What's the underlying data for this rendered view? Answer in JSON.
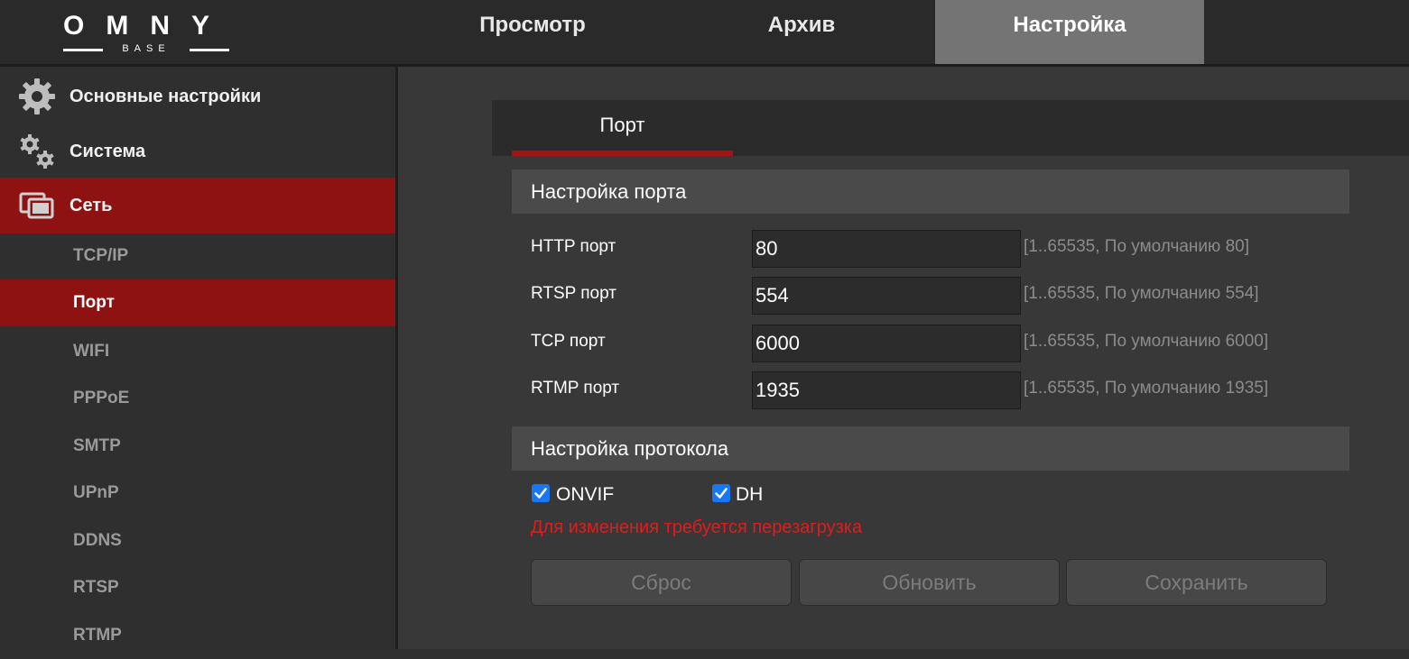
{
  "header": {
    "logo": {
      "main": "OMNY",
      "sub": "BASE"
    },
    "tabs": [
      {
        "label": "Просмотр"
      },
      {
        "label": "Архив"
      },
      {
        "label": "Настройка",
        "active": true
      }
    ]
  },
  "sidebar": {
    "sections": [
      {
        "label": "Основные настройки",
        "icon": "gear-icon"
      },
      {
        "label": "Система",
        "icon": "gears-icon"
      },
      {
        "label": "Сеть",
        "icon": "network-icon",
        "active": true
      }
    ],
    "subitems": [
      "TCP/IP",
      "Порт",
      "WIFI",
      "PPPoE",
      "SMTP",
      "UPnP",
      "DDNS",
      "RTSP",
      "RTMP"
    ],
    "active_subitem": "Порт"
  },
  "main": {
    "tab": "Порт",
    "port_section": {
      "title": "Настройка порта",
      "fields": [
        {
          "label": "HTTP порт",
          "value": "80",
          "hint": "[1..65535, По умолчанию 80]"
        },
        {
          "label": "RTSP порт",
          "value": "554",
          "hint": "[1..65535, По умолчанию 554]"
        },
        {
          "label": "TCP порт",
          "value": "6000",
          "hint": "[1..65535, По умолчанию 6000]"
        },
        {
          "label": "RTMP порт",
          "value": "1935",
          "hint": "[1..65535, По умолчанию 1935]"
        }
      ]
    },
    "protocol_section": {
      "title": "Настройка протокола",
      "options": [
        {
          "label": "ONVIF",
          "checked": true
        },
        {
          "label": "DH",
          "checked": true
        }
      ],
      "warning": "Для изменения требуется перезагрузка"
    },
    "buttons": {
      "reset": "Сброс",
      "refresh": "Обновить",
      "save": "Сохранить"
    }
  },
  "colors": {
    "accent_red": "#8f1212",
    "warning_red": "#e01c1c",
    "checkbox_blue": "#1877f2",
    "active_tab_gray": "#747474"
  }
}
